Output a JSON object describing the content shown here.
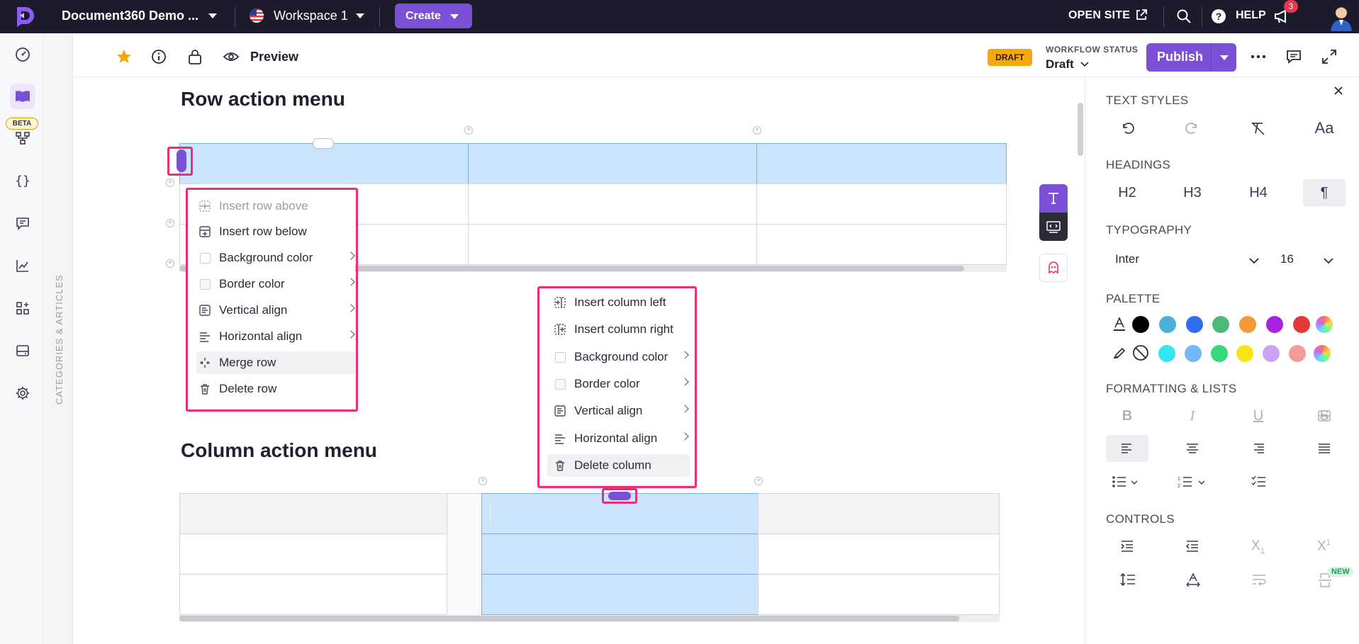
{
  "topbar": {
    "project_name": "Document360 Demo ...",
    "workspace": "Workspace 1",
    "create_label": "Create",
    "open_site_label": "OPEN SITE",
    "help_label": "HELP",
    "notification_count": "3"
  },
  "rail": {
    "beta_label": "BETA",
    "categories_label": "CATEGORIES & ARTICLES"
  },
  "toolbar": {
    "preview_label": "Preview",
    "status_badge": "DRAFT",
    "workflow_label": "WORKFLOW STATUS",
    "workflow_value": "Draft",
    "publish_label": "Publish"
  },
  "editor": {
    "heading_row": "Row action menu",
    "heading_column": "Column action menu"
  },
  "row_menu": {
    "items": [
      {
        "label": "Insert row above",
        "icon": "insert-row-above-icon",
        "disabled": true
      },
      {
        "label": "Insert row below",
        "icon": "insert-row-below-icon"
      },
      {
        "label": "Background color",
        "icon": "color-swatch-icon",
        "submenu": true
      },
      {
        "label": "Border color",
        "icon": "color-swatch-icon",
        "submenu": true
      },
      {
        "label": "Vertical align",
        "icon": "vertical-align-icon",
        "submenu": true
      },
      {
        "label": "Horizontal align",
        "icon": "horizontal-align-icon",
        "submenu": true
      },
      {
        "label": "Merge row",
        "icon": "merge-icon",
        "highlighted": true
      },
      {
        "label": "Delete row",
        "icon": "trash-icon"
      }
    ]
  },
  "column_menu": {
    "items": [
      {
        "label": "Insert column left",
        "icon": "insert-column-left-icon"
      },
      {
        "label": "Insert column right",
        "icon": "insert-column-right-icon"
      },
      {
        "label": "Background color",
        "icon": "color-swatch-icon",
        "submenu": true
      },
      {
        "label": "Border color",
        "icon": "color-swatch-icon",
        "submenu": true
      },
      {
        "label": "Vertical align",
        "icon": "vertical-align-icon",
        "submenu": true
      },
      {
        "label": "Horizontal align",
        "icon": "horizontal-align-icon",
        "submenu": true
      },
      {
        "label": "Delete column",
        "icon": "trash-icon",
        "highlighted": true
      }
    ]
  },
  "panel": {
    "text_styles": "TEXT STYLES",
    "headings": "HEADINGS",
    "h2": "H2",
    "h3": "H3",
    "h4": "H4",
    "paragraph": "¶",
    "typography": "TYPOGRAPHY",
    "font_family": "Inter",
    "font_size": "16",
    "palette": "PALETTE",
    "formatting": "FORMATTING & LISTS",
    "controls": "CONTROLS",
    "new_badge": "NEW",
    "text_colors": [
      "#000000",
      "#4ab0d9",
      "#2f6df2",
      "#4cb87a",
      "#f39a37",
      "#a822e3",
      "#e33939"
    ],
    "highlight_colors": [
      "#33e6f2",
      "#72b7f7",
      "#33d97a",
      "#f7e614",
      "#c9a3f5",
      "#f59a9a"
    ]
  },
  "colors": {
    "accent": "#7b4fd6",
    "highlight_frame": "#e8307a",
    "selection": "#c9e4fb",
    "draft": "#f9a806"
  }
}
